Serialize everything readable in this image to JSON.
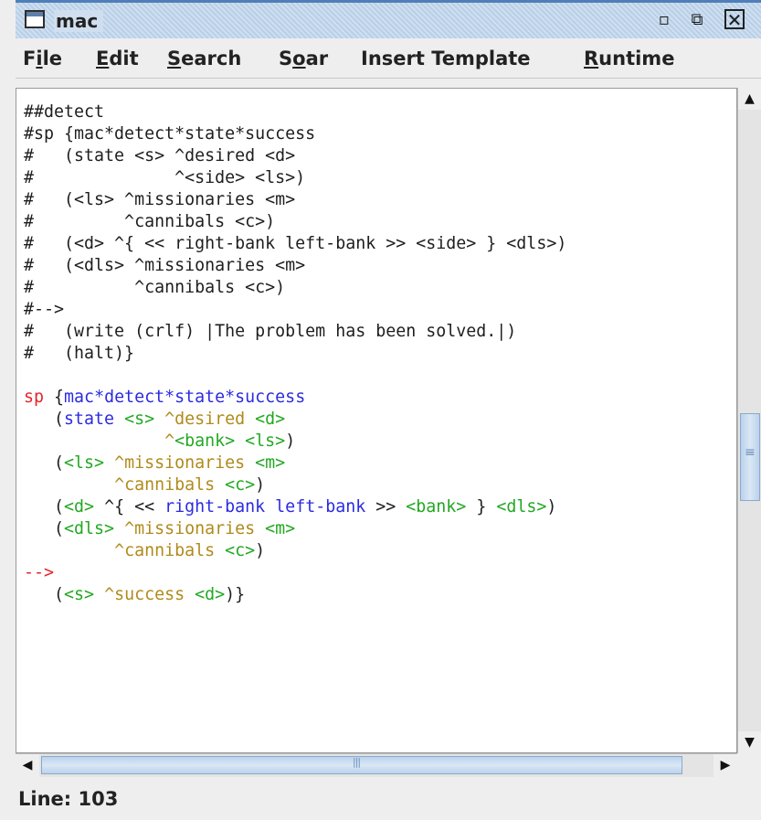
{
  "window": {
    "title": "mac",
    "min_glyph": "▫",
    "max_glyph": "⧉",
    "close_glyph": "✕"
  },
  "menu": [
    {
      "pre": "F",
      "u": "i",
      "post": "le"
    },
    {
      "pre": "",
      "u": "E",
      "post": "dit"
    },
    {
      "pre": "",
      "u": "S",
      "post": "earch"
    },
    {
      "pre": "S",
      "u": "o",
      "post": "ar"
    },
    {
      "pre": "Insert Template",
      "u": "",
      "post": ""
    },
    {
      "pre": "",
      "u": "R",
      "post": "untime"
    }
  ],
  "colors": {
    "default": "#1e1e1e",
    "keyword": "#e8232a",
    "name": "#2b2be0",
    "variable": "#22a822",
    "attribute": "#b08a1a",
    "symbol": "#1e1e1e"
  },
  "code_lines": [
    [
      [
        "default",
        "##detect"
      ]
    ],
    [
      [
        "default",
        "#sp {mac*detect*state*success"
      ]
    ],
    [
      [
        "default",
        "#   (state <s> ^desired <d>"
      ]
    ],
    [
      [
        "default",
        "#              ^<side> <ls>)"
      ]
    ],
    [
      [
        "default",
        "#   (<ls> ^missionaries <m>"
      ]
    ],
    [
      [
        "default",
        "#         ^cannibals <c>)"
      ]
    ],
    [
      [
        "default",
        "#   (<d> ^{ << right-bank left-bank >> <side> } <dls>)"
      ]
    ],
    [
      [
        "default",
        "#   (<dls> ^missionaries <m>"
      ]
    ],
    [
      [
        "default",
        "#          ^cannibals <c>)"
      ]
    ],
    [
      [
        "default",
        "#-->"
      ]
    ],
    [
      [
        "default",
        "#   (write (crlf) |The problem has been solved.|)"
      ]
    ],
    [
      [
        "default",
        "#   (halt)}"
      ]
    ],
    [],
    [
      [
        "keyword",
        "sp "
      ],
      [
        "symbol",
        "{"
      ],
      [
        "name",
        "mac*detect*state*success"
      ]
    ],
    [
      [
        "symbol",
        "   ("
      ],
      [
        "name",
        "state "
      ],
      [
        "variable",
        "<s> "
      ],
      [
        "attribute",
        "^desired "
      ],
      [
        "variable",
        "<d>"
      ]
    ],
    [
      [
        "symbol",
        "              "
      ],
      [
        "attribute",
        "^"
      ],
      [
        "variable",
        "<bank> <ls>"
      ],
      [
        "symbol",
        ")"
      ]
    ],
    [
      [
        "symbol",
        "   ("
      ],
      [
        "variable",
        "<ls> "
      ],
      [
        "attribute",
        "^missionaries "
      ],
      [
        "variable",
        "<m>"
      ]
    ],
    [
      [
        "symbol",
        "         "
      ],
      [
        "attribute",
        "^cannibals "
      ],
      [
        "variable",
        "<c>"
      ],
      [
        "symbol",
        ")"
      ]
    ],
    [
      [
        "symbol",
        "   ("
      ],
      [
        "variable",
        "<d> "
      ],
      [
        "symbol",
        "^{ << "
      ],
      [
        "name",
        "right-bank left-bank "
      ],
      [
        "symbol",
        ">> "
      ],
      [
        "variable",
        "<bank> "
      ],
      [
        "symbol",
        "} "
      ],
      [
        "variable",
        "<dls>"
      ],
      [
        "symbol",
        ")"
      ]
    ],
    [
      [
        "symbol",
        "   ("
      ],
      [
        "variable",
        "<dls> "
      ],
      [
        "attribute",
        "^missionaries "
      ],
      [
        "variable",
        "<m>"
      ]
    ],
    [
      [
        "symbol",
        "         "
      ],
      [
        "attribute",
        "^cannibals "
      ],
      [
        "variable",
        "<c>"
      ],
      [
        "symbol",
        ")"
      ]
    ],
    [
      [
        "keyword",
        "-->"
      ]
    ],
    [
      [
        "symbol",
        "   ("
      ],
      [
        "variable",
        "<s> "
      ],
      [
        "attribute",
        "^success "
      ],
      [
        "variable",
        "<d>"
      ],
      [
        "symbol",
        ")}"
      ]
    ]
  ],
  "scroll": {
    "up_glyph": "▲",
    "down_glyph": "▼",
    "left_glyph": "◀",
    "right_glyph": "▶"
  },
  "status": {
    "text": "Line: 103"
  }
}
